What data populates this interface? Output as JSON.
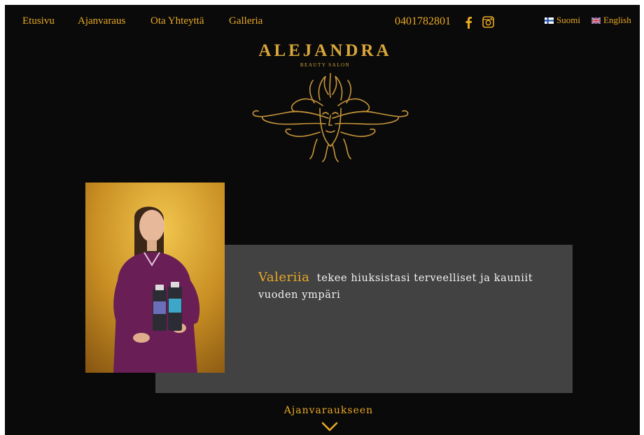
{
  "nav": {
    "items": [
      {
        "label": "Etusivu"
      },
      {
        "label": "Ajanvaraus"
      },
      {
        "label": "Ota Yhteyttä"
      },
      {
        "label": "Galleria"
      }
    ],
    "phone": "0401782801",
    "social": [
      "facebook-icon",
      "instagram-icon"
    ],
    "languages": [
      {
        "label": "Suomi",
        "flag": "finland-flag"
      },
      {
        "label": "English",
        "flag": "uk-flag"
      }
    ]
  },
  "logo": {
    "title": "ALEJANDRA",
    "subtitle": "BEAUTY SALON"
  },
  "hero": {
    "name": "Valeriia",
    "text": "tekee hiuksistasi terveelliset ja kauniit vuoden ympäri"
  },
  "cta": {
    "label": "Ajanvaraukseen"
  },
  "colors": {
    "accent": "#e8a825",
    "background": "#0a0a0a",
    "panel": "#424242"
  }
}
